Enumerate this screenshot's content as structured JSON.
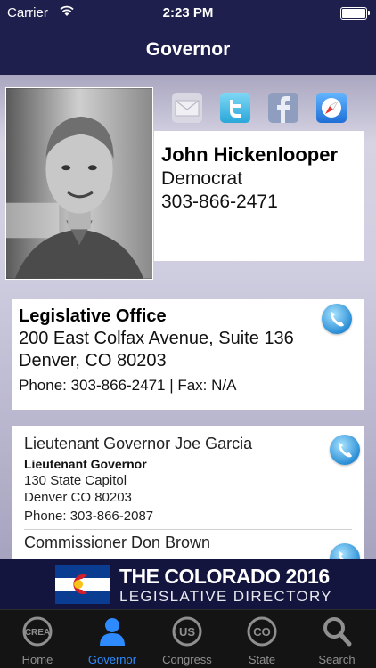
{
  "status": {
    "carrier": "Carrier",
    "time": "2:23 PM"
  },
  "nav": {
    "title": "Governor"
  },
  "governor": {
    "name": "John Hickenlooper",
    "party": "Democrat",
    "phone": "303-866-2471"
  },
  "office": {
    "heading": "Legislative Office",
    "address1": "200 East Colfax Avenue, Suite 136",
    "address2": "Denver, CO 80203",
    "phone_fax": "Phone: 303-866-2471 | Fax: N/A"
  },
  "staff": [
    {
      "name": "Lieutenant Governor Joe Garcia",
      "title": "Lieutenant Governor",
      "address1": "130 State Capitol",
      "address2": "Denver CO 80203",
      "phone": "Phone: 303-866-2087"
    },
    {
      "name": "Commissioner Don  Brown"
    }
  ],
  "banner": {
    "line1": "THE COLORADO 2016",
    "line2": "LEGISLATIVE DIRECTORY"
  },
  "tabs": [
    {
      "label": "Home",
      "icon": "crea-icon",
      "badge": "CREA"
    },
    {
      "label": "Governor",
      "icon": "person-icon",
      "active": true
    },
    {
      "label": "Congress",
      "icon": "us-icon",
      "badge": "US"
    },
    {
      "label": "State",
      "icon": "co-icon",
      "badge": "CO"
    },
    {
      "label": "Search",
      "icon": "magnifier-icon"
    }
  ],
  "colors": {
    "nav_bg": "#1e1f4d",
    "tab_active": "#2d8bff",
    "tab_inactive": "#8f8f8f"
  }
}
